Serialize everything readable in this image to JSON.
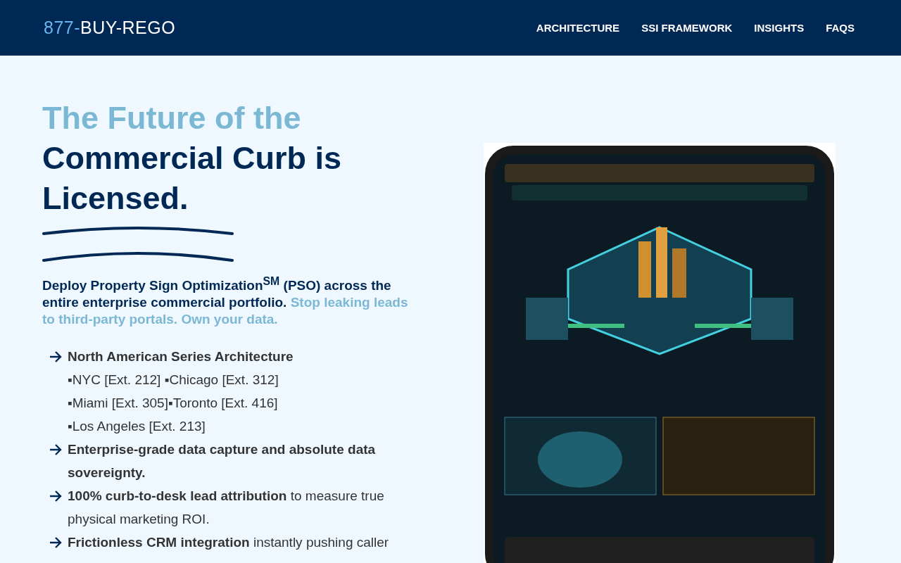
{
  "header": {
    "logo_prefix": "877-",
    "logo_main": "BUY-REGO",
    "nav": [
      {
        "label": "ARCHITECTURE"
      },
      {
        "label": "SSI FRAMEWORK"
      },
      {
        "label": "INSIGHTS"
      },
      {
        "label": "FAQS"
      }
    ]
  },
  "hero": {
    "headline_lead": "The Future of the",
    "headline_main": "Commercial Curb is Licensed.",
    "intro": [
      {
        "text": "Deploy Property Sign Optimization$^{SM}$ (PSO) across the entire enterprise commercial portfolio.",
        "highlight": false
      },
      {
        "text": "Stop leaking leads to third-party portals. Own your data.",
        "highlight": true
      }
    ],
    "points": [
      {
        "kind": "bullet",
        "text": "**North American Series Architecture**"
      },
      {
        "kind": "subline",
        "text": "▪NYC [Ext. 212] ▪Chicago [Ext. 312]"
      },
      {
        "kind": "subline",
        "text": "▪Miami [Ext. 305]▪Toronto [Ext. 416]"
      },
      {
        "kind": "subline",
        "text": "▪Los Angeles [Ext. 213]"
      },
      {
        "kind": "bullet",
        "text": "**Enterprise-grade data capture and absolute data sovereignty.**"
      },
      {
        "kind": "bullet",
        "text": "**100% curb-to-desk lead attribution** to measure true physical marketing ROI."
      },
      {
        "kind": "bullet",
        "text": "**Frictionless CRM integration** instantly pushing caller"
      }
    ]
  }
}
